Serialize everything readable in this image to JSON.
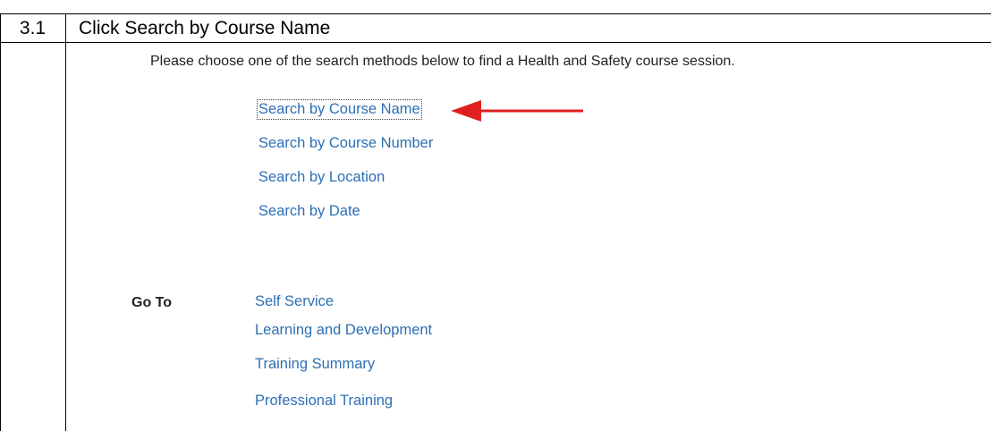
{
  "step": {
    "number": "3.1",
    "title": "Click Search by Course Name"
  },
  "screenshot": {
    "intro_text": "Please choose one of the search methods below to find a Health and Safety course session.",
    "search_links": [
      "Search by Course Name",
      "Search by Course Number",
      "Search by Location",
      "Search by Date"
    ],
    "goto": {
      "label": "Go To",
      "links": [
        "Self Service",
        "Learning and Development",
        "Training Summary",
        "Professional Training"
      ]
    },
    "colors": {
      "link": "#2d6fb5",
      "arrow": "#e02020"
    },
    "annotation": "red-arrow-icon"
  }
}
